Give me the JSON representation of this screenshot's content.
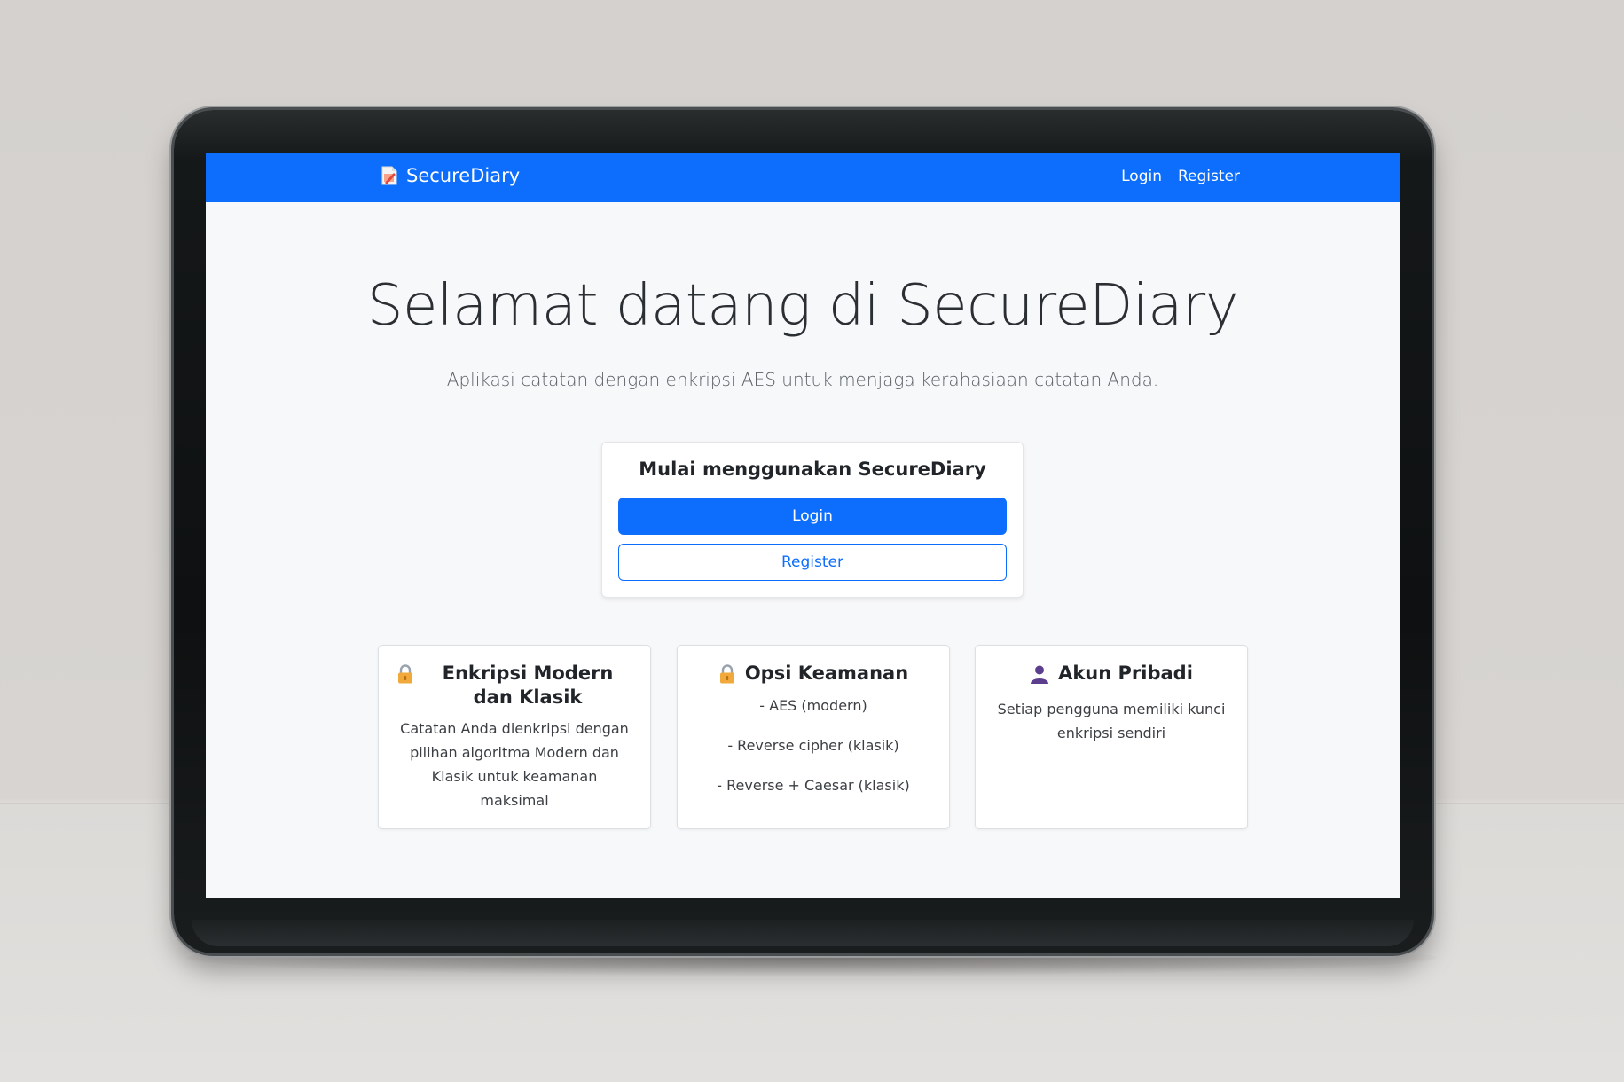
{
  "navbar": {
    "brand": "SecureDiary",
    "brand_icon": "memo-icon",
    "links": [
      "Login",
      "Register"
    ],
    "color": "#0d6efd"
  },
  "hero": {
    "title": "Selamat datang di SecureDiary",
    "subtitle": "Aplikasi catatan dengan enkripsi AES untuk menjaga kerahasiaan catatan Anda."
  },
  "start_card": {
    "title": "Mulai menggunakan SecureDiary",
    "login_label": "Login",
    "register_label": "Register"
  },
  "features": [
    {
      "icon": "lock-icon",
      "title": "Enkripsi Modern dan Klasik",
      "text": "Catatan Anda dienkripsi dengan pilihan algoritma Modern dan Klasik untuk keamanan maksimal"
    },
    {
      "icon": "lock-icon",
      "title": "Opsi Keamanan",
      "items": [
        "- AES (modern)",
        "- Reverse cipher (klasik)",
        "- Reverse + Caesar (klasik)"
      ]
    },
    {
      "icon": "user-icon",
      "title": "Akun Pribadi",
      "text": "Setiap pengguna memiliki kunci enkripsi sendiri"
    }
  ]
}
